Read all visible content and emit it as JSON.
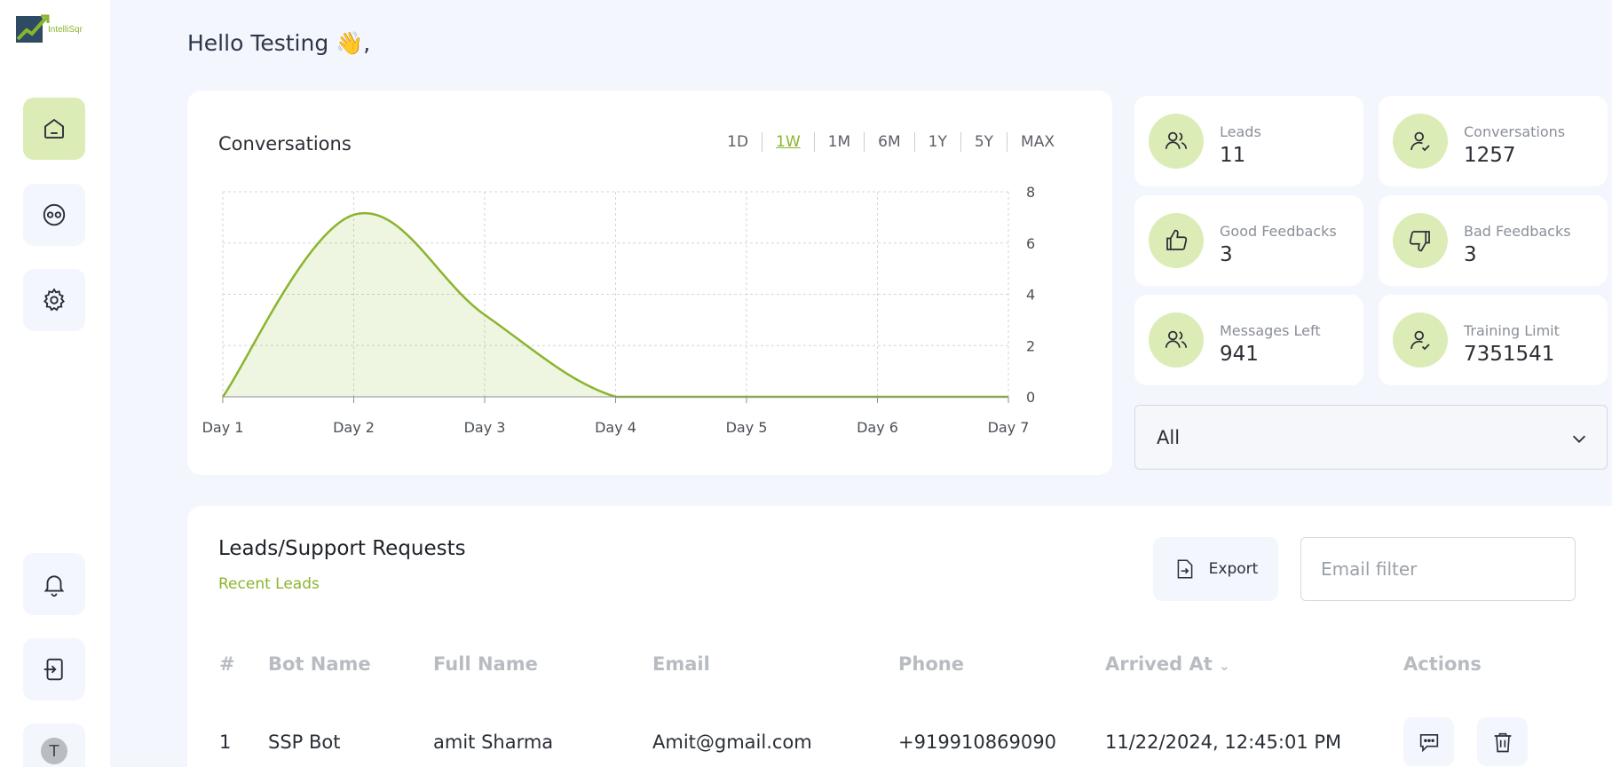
{
  "brand": {
    "logo_text": "IntelliSqr",
    "accent": "#8ab52e",
    "accent_light": "#dcecb7"
  },
  "sidebar": {
    "items": [
      {
        "icon": "home-icon",
        "active": true
      },
      {
        "icon": "bot-icon",
        "active": false
      },
      {
        "icon": "gear-icon",
        "active": false
      }
    ],
    "bottom": [
      {
        "icon": "bell-icon"
      },
      {
        "icon": "logout-icon"
      }
    ],
    "avatar_initial": "T"
  },
  "greeting": "Hello Testing 👋,",
  "conversations_chart": {
    "title": "Conversations",
    "ranges": [
      "1D",
      "1W",
      "1M",
      "6M",
      "1Y",
      "5Y",
      "MAX"
    ],
    "active_range": "1W"
  },
  "chart_data": {
    "type": "area",
    "x": [
      "Day 1",
      "Day 2",
      "Day 3",
      "Day 4",
      "Day 5",
      "Day 6",
      "Day 7"
    ],
    "series": [
      {
        "values": [
          0,
          7.1,
          3.2,
          0,
          0,
          0,
          0
        ]
      }
    ],
    "yticks": [
      "0",
      "2",
      "4",
      "6",
      "8"
    ],
    "ylim": [
      0,
      8
    ],
    "grid": true,
    "y_axis_side": "right",
    "color": "#8ab52e"
  },
  "stats": [
    {
      "label": "Leads",
      "value": "11",
      "icon": "users-icon"
    },
    {
      "label": "Conversations",
      "value": "1257",
      "icon": "user-check-icon"
    },
    {
      "label": "Good Feedbacks",
      "value": "3",
      "icon": "thumbs-up-icon"
    },
    {
      "label": "Bad Feedbacks",
      "value": "3",
      "icon": "thumbs-down-icon"
    },
    {
      "label": "Messages Left",
      "value": "941",
      "icon": "users-icon"
    },
    {
      "label": "Training Limit",
      "value": "7351541",
      "icon": "user-check-icon"
    }
  ],
  "filter_select": {
    "value": "All"
  },
  "leads": {
    "title": "Leads/Support Requests",
    "subtitle": "Recent Leads",
    "export_label": "Export",
    "email_filter_placeholder": "Email filter",
    "columns": [
      "#",
      "Bot Name",
      "Full Name",
      "Email",
      "Phone",
      "Arrived At",
      "Actions"
    ],
    "sort_indicator": "⌄",
    "rows": [
      {
        "index": "1",
        "bot_name": "SSP Bot",
        "full_name": "amit Sharma",
        "email": "Amit@gmail.com",
        "phone": "+919910869090",
        "arrived_at": "11/22/2024, 12:45:01 PM"
      }
    ]
  }
}
